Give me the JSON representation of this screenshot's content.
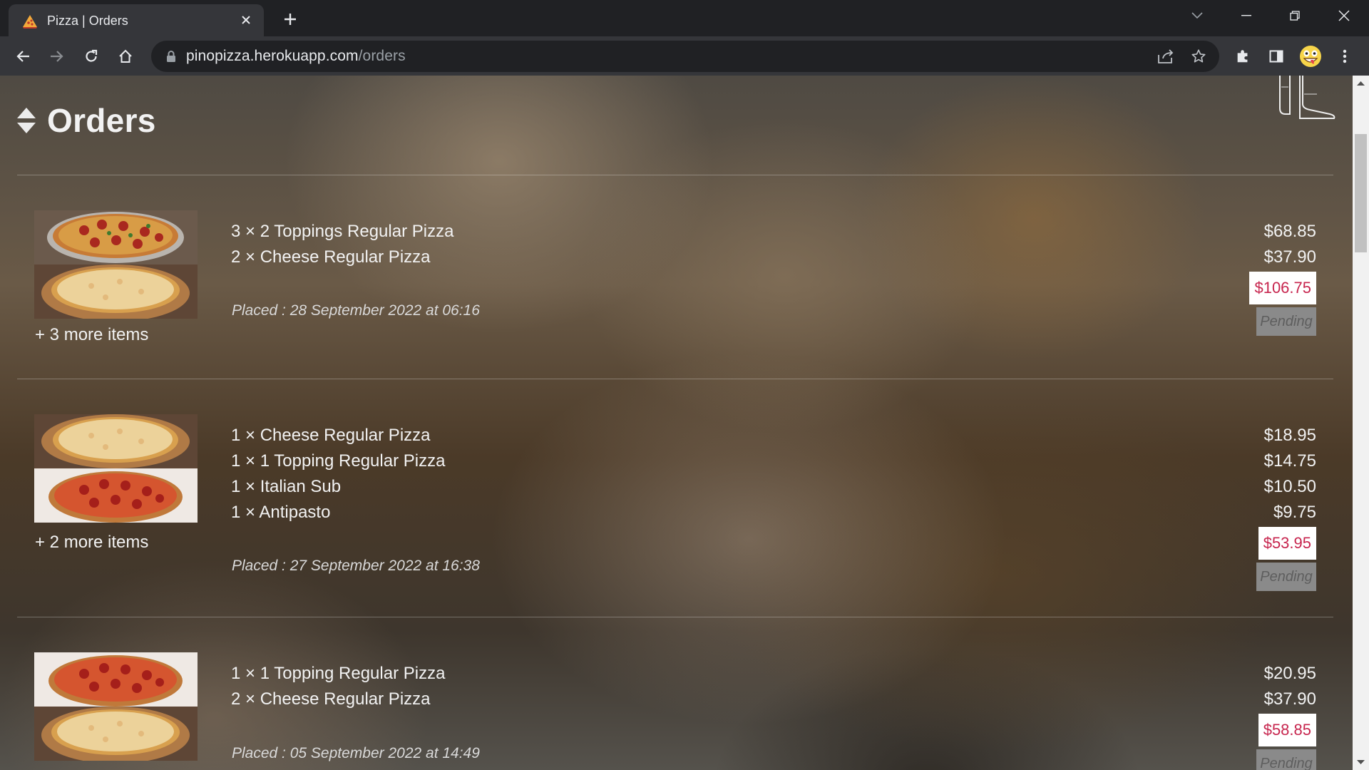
{
  "browser": {
    "tab_title": "Pizza | Orders",
    "url_host": "pinopizza.herokuapp.com",
    "url_path": "/orders"
  },
  "page": {
    "title": "Orders"
  },
  "orders": [
    {
      "items": [
        {
          "label": "3 × 2 Toppings Regular Pizza",
          "price": "$68.85"
        },
        {
          "label": "2 × Cheese Regular Pizza",
          "price": "$37.90"
        }
      ],
      "more": "+ 3 more items",
      "placed": "Placed : 28 September 2022 at 06:16",
      "total": "$106.75",
      "status": "Pending"
    },
    {
      "items": [
        {
          "label": "1 × Cheese Regular Pizza",
          "price": "$18.95"
        },
        {
          "label": "1 × 1 Topping Regular Pizza",
          "price": "$14.75"
        },
        {
          "label": "1 × Italian Sub",
          "price": "$10.50"
        },
        {
          "label": "1 × Antipasto",
          "price": "$9.75"
        }
      ],
      "more": "+ 2 more items",
      "placed": "Placed : 27 September 2022 at 16:38",
      "total": "$53.95",
      "status": "Pending"
    },
    {
      "items": [
        {
          "label": "1 × 1 Topping Regular Pizza",
          "price": "$20.95"
        },
        {
          "label": "2 × Cheese Regular Pizza",
          "price": "$37.90"
        }
      ],
      "more": "",
      "placed": "Placed : 05 September 2022 at 14:49",
      "total": "$58.85",
      "status": "Pending"
    }
  ],
  "colors": {
    "total_text": "#c7254e",
    "status_bg": "#8a8a8a"
  }
}
